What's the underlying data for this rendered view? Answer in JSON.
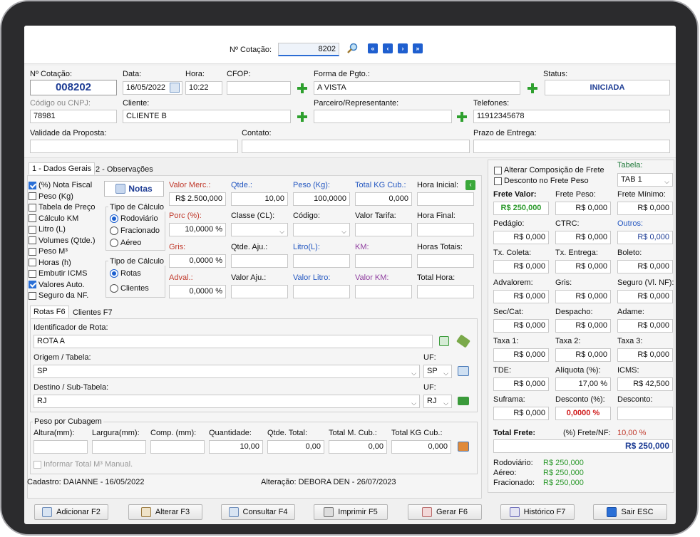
{
  "top": {
    "cotacao_label": "Nº Cotação:",
    "cotacao_value": "8202"
  },
  "header": {
    "n_cotacao_label": "Nº Cotação:",
    "n_cotacao": "008202",
    "data_label": "Data:",
    "data": "16/05/2022",
    "hora_label": "Hora:",
    "hora": "10:22",
    "cfop_label": "CFOP:",
    "cfop": "",
    "forma_label": "Forma de Pgto.:",
    "forma": "A VISTA",
    "status_label": "Status:",
    "status": "INICIADA",
    "codigo_label": "Código ou CNPJ:",
    "codigo": "78981",
    "cliente_label": "Cliente:",
    "cliente": "CLIENTE B",
    "parceiro_label": "Parceiro/Representante:",
    "parceiro": "",
    "telefones_label": "Telefones:",
    "telefones": "11912345678",
    "validade_label": "Validade da Proposta:",
    "contato_label": "Contato:",
    "prazo_label": "Prazo de Entrega:"
  },
  "tabs": {
    "t1": "1 - Dados Gerais",
    "t2": "2 - Observações"
  },
  "checks": [
    {
      "label": "(%) Nota Fiscal",
      "on": true
    },
    {
      "label": "Peso (Kg)",
      "on": false
    },
    {
      "label": "Tabela de Preço",
      "on": false
    },
    {
      "label": "Cálculo KM",
      "on": false
    },
    {
      "label": "Litro (L)",
      "on": false
    },
    {
      "label": "Volumes (Qtde.)",
      "on": false
    },
    {
      "label": "Peso M³",
      "on": false
    },
    {
      "label": "Horas (h)",
      "on": false
    },
    {
      "label": "Embutir ICMS",
      "on": false
    },
    {
      "label": "Valores Auto.",
      "on": true
    },
    {
      "label": "Seguro da NF.",
      "on": false
    }
  ],
  "notas": "Notas",
  "tipo1": {
    "label": "Tipo de Cálculo",
    "o1": "Rodoviário",
    "o2": "Fracionado",
    "o3": "Aéreo"
  },
  "tipo2": {
    "label": "Tipo de Cálculo",
    "o1": "Rotas",
    "o2": "Clientes"
  },
  "fields": {
    "valor_merc_l": "Valor Merc.:",
    "valor_merc": "R$ 2.500,000",
    "qtde_l": "Qtde.:",
    "qtde": "10,00",
    "peso_l": "Peso (Kg):",
    "peso": "100,0000",
    "total_kg_l": "Total KG Cub.:",
    "total_kg": "0,000",
    "hora_ini_l": "Hora Inicial:",
    "porc_l": "Porc (%):",
    "porc": "10,0000 %",
    "classe_l": "Classe (CL):",
    "codigo_l": "Código:",
    "valor_tarifa_l": "Valor Tarifa:",
    "hora_fin_l": "Hora Final:",
    "gris_l": "Gris:",
    "gris": "0,0000 %",
    "qtde_aju_l": "Qtde. Aju.:",
    "litro_l": "Litro(L):",
    "km_l": "KM:",
    "horas_tot_l": "Horas Totais:",
    "advol_l": "Adval.:",
    "advol": "0,0000 %",
    "valor_aju_l": "Valor Aju.:",
    "valor_litro_l": "Valor Litro:",
    "valor_km_l": "Valor KM:",
    "total_hora_l": "Total Hora:"
  },
  "subtabs": {
    "t1": "Rotas F6",
    "t2": "Clientes F7"
  },
  "rota": {
    "ident_l": "Identificador de Rota:",
    "ident": "ROTA A",
    "origem_l": "Origem / Tabela:",
    "origem": "SP",
    "uf_l": "UF:",
    "uf_o": "SP",
    "destino_l": "Destino / Sub-Tabela:",
    "destino": "RJ",
    "uf_d": "RJ"
  },
  "cubagem": {
    "title": "Peso por Cubagem",
    "altura": "Altura(mm):",
    "largura": "Largura(mm):",
    "comp": "Comp. (mm):",
    "quant": "Quantidade:",
    "quant_v": "10,00",
    "qtotal": "Qtde. Total:",
    "qtotal_v": "0,00",
    "tmcub": "Total M. Cub.:",
    "tmcub_v": "0,00",
    "tkg": "Total KG Cub.:",
    "tkg_v": "0,000",
    "manual": "Informar Total M³ Manual."
  },
  "footer": {
    "cadastro": "Cadastro:  DAIANNE - 16/05/2022",
    "alteracao": "Alteração:  DEBORA DEN - 26/07/2023"
  },
  "right": {
    "alterar": "Alterar Composição de Frete",
    "desconto_peso": "Desconto no Frete Peso",
    "tabela_l": "Tabela:",
    "tabela": "TAB 1",
    "frete_valor_l": "Frete Valor:",
    "frete_valor": "R$ 250,000",
    "frete_peso_l": "Frete Peso:",
    "frete_peso": "R$ 0,000",
    "frete_min_l": "Frete Mínimo:",
    "frete_min": "R$ 0,000",
    "pedagio_l": "Pedágio:",
    "pedagio": "R$ 0,000",
    "ctrc_l": "CTRC:",
    "ctrc": "R$ 0,000",
    "outros_l": "Outros:",
    "outros": "R$ 0,000",
    "txcol_l": "Tx. Coleta:",
    "txcol": "R$ 0,000",
    "txent_l": "Tx. Entrega:",
    "txent": "R$ 0,000",
    "boleto_l": "Boleto:",
    "boleto": "R$ 0,000",
    "advalorem_l": "Advalorem:",
    "advalorem": "R$ 0,000",
    "gris_l": "Gris:",
    "gris": "R$ 0,000",
    "seguro_l": "Seguro (Vl. NF):",
    "seguro": "R$ 0,000",
    "seccat_l": "Sec/Cat:",
    "seccat": "R$ 0,000",
    "despacho_l": "Despacho:",
    "despacho": "R$ 0,000",
    "adame_l": "Adame:",
    "adame": "R$ 0,000",
    "taxa1_l": "Taxa 1:",
    "taxa1": "R$ 0,000",
    "taxa2_l": "Taxa 2:",
    "taxa2": "R$ 0,000",
    "taxa3_l": "Taxa 3:",
    "taxa3": "R$ 0,000",
    "tde_l": "TDE:",
    "tde": "R$ 0,000",
    "aliq_l": "Alíquota (%):",
    "aliq": "17,00 %",
    "icms_l": "ICMS:",
    "icms": "R$ 42,500",
    "suframa_l": "Suframa:",
    "suframa": "R$ 0,000",
    "desc_pct_l": "Desconto (%):",
    "desc_pct": "0,0000 %",
    "desc_l": "Desconto:",
    "desc": "",
    "total_frete_l": "Total Frete:",
    "frete_nf_l": "(%) Frete/NF:",
    "frete_nf": "10,00 %",
    "total_frete": "R$ 250,000",
    "rod_l": "Rodoviário:",
    "rod": "R$ 250,000",
    "aer_l": "Aéreo:",
    "aer": "R$ 250,000",
    "fra_l": "Fracionado:",
    "fra": "R$ 250,000"
  },
  "buttons": {
    "b1": "Adicionar F2",
    "b2": "Alterar F3",
    "b3": "Consultar F4",
    "b4": "Imprimir F5",
    "b5": "Gerar F6",
    "b6": "Histórico F7",
    "b7": "Sair ESC"
  }
}
